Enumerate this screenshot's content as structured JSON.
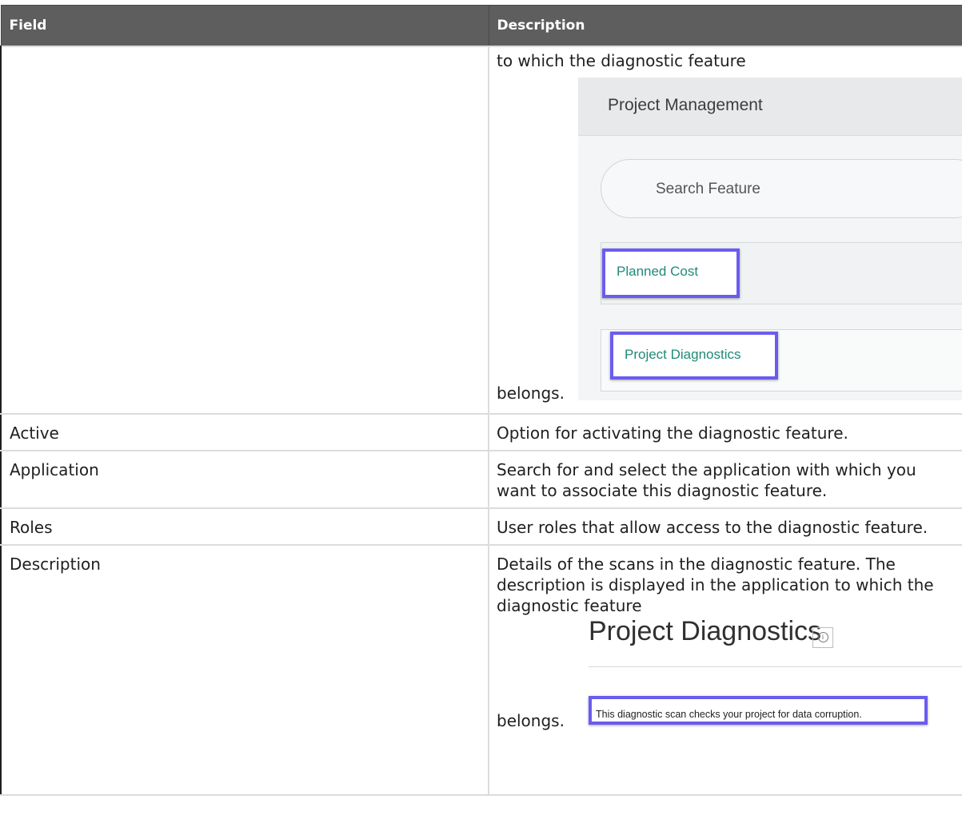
{
  "table": {
    "header": {
      "field": "Field",
      "description": "Description"
    },
    "row_project": {
      "desc_top": "to which the diagnostic feature",
      "desc_bottom": "belongs.",
      "screenshot": {
        "header_title": "Project Management",
        "search_placeholder": "Search Feature",
        "feature_1": "Planned Cost",
        "feature_2": "Project Diagnostics"
      }
    },
    "rows": [
      {
        "field": "Active",
        "description": "Option for activating the diagnostic feature."
      },
      {
        "field": "Application",
        "description": "Search for and select the application with which you want to associate this diagnostic feature."
      },
      {
        "field": "Roles",
        "description": "User roles that allow access to the diagnostic feature."
      }
    ],
    "row_description": {
      "field": "Description",
      "description": "Details of the scans in the diagnostic feature. The description is displayed in the application to which the diagnostic feature",
      "screenshot": {
        "title": "Project Diagnostics",
        "note": "This diagnostic scan checks your project for data corruption."
      },
      "desc_end": "belongs."
    }
  }
}
